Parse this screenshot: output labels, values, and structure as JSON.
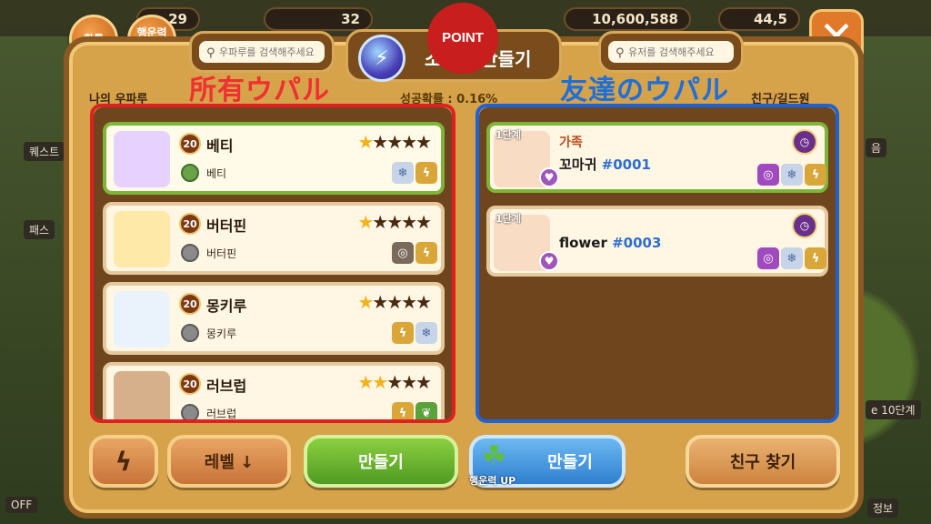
{
  "top": {
    "stat_left": "29",
    "stat_mid": "32",
    "stat_gold": "10,600,588",
    "stat_right": "44,5"
  },
  "round_buttons": {
    "prob": "확률",
    "luck_prob": "행운력 확률"
  },
  "search_left_placeholder": "우파루를 검색해주세요",
  "search_right_placeholder": "유저를 검색해주세요",
  "title": "소환석 만들기",
  "point_badge": "POINT",
  "success_rate": "성공확률 : 0.16%",
  "left_header": "나의 우파루",
  "right_header": "친구/길드원",
  "annotations": {
    "left": "所有ウパル",
    "right": "友達のウパル"
  },
  "my_upals": [
    {
      "level": "20",
      "name": "베티",
      "sub": "베티",
      "stars": 1,
      "total_stars": 5,
      "selected": true
    },
    {
      "level": "20",
      "name": "버터핀",
      "sub": "버터핀",
      "stars": 1,
      "total_stars": 5,
      "selected": false
    },
    {
      "level": "20",
      "name": "몽키루",
      "sub": "몽키루",
      "stars": 1,
      "total_stars": 5,
      "selected": false
    },
    {
      "level": "20",
      "name": "러브럽",
      "sub": "러브럽",
      "stars": 2,
      "total_stars": 5,
      "selected": false
    }
  ],
  "friend_upals": [
    {
      "stage": "1단계",
      "clan": "가족",
      "name": "꼬마귀",
      "tag": "#0001",
      "limited": "LIMITED",
      "selected": true
    },
    {
      "stage": "1단계",
      "clan": "",
      "name": "flower",
      "tag": "#0003",
      "limited": "LIMITED",
      "selected": false
    }
  ],
  "buttons": {
    "level_sort": "레벨 ↓",
    "make": "만들기",
    "make_luck": "만들기",
    "luck_up": "행운력 UP",
    "find_friend": "친구 찾기"
  },
  "side": {
    "quest": "퀘스트",
    "pass": "패스",
    "stage10": "e 10단계",
    "info": "정보",
    "off": "OFF",
    "uno": "음"
  },
  "colors": {
    "annotation_red": "#f03030",
    "annotation_blue": "#1e6fd8",
    "frame_red": "#e02020",
    "frame_blue": "#1e62d8"
  }
}
